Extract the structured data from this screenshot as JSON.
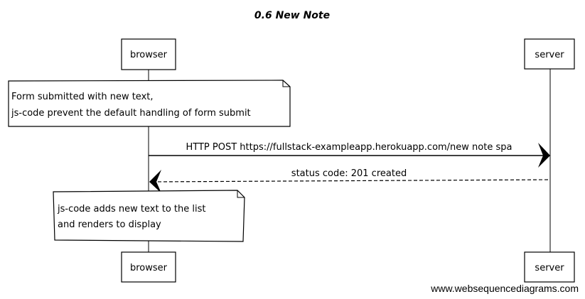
{
  "title": "0.6 New Note",
  "participants": {
    "browser": "browser",
    "server": "server"
  },
  "notes": [
    {
      "lines": [
        "Form submitted with new text,",
        "js-code prevent the default handling of form submit"
      ]
    },
    {
      "lines": [
        "js-code adds new text to the list",
        "and renders to display"
      ]
    }
  ],
  "messages": [
    {
      "label": "HTTP POST https://fullstack-exampleapp.herokuapp.com/new note spa",
      "style": "solid"
    },
    {
      "label": "status code: 201 created",
      "style": "dashed"
    }
  ],
  "watermark": "www.websequencediagrams.com"
}
